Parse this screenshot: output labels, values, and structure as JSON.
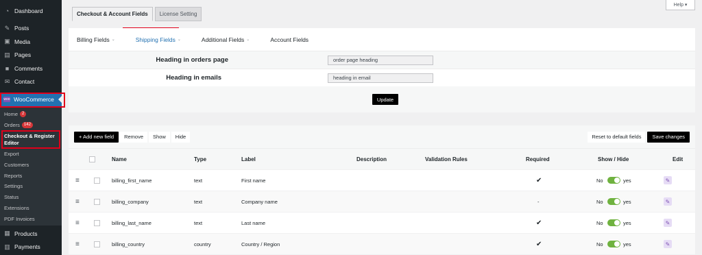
{
  "sidebar": {
    "items": [
      {
        "label": "Dashboard",
        "icon": "dashboard-icon"
      },
      {
        "label": "Posts",
        "icon": "pin-icon"
      },
      {
        "label": "Media",
        "icon": "media-icon"
      },
      {
        "label": "Pages",
        "icon": "pages-icon"
      },
      {
        "label": "Comments",
        "icon": "comments-icon"
      },
      {
        "label": "Contact",
        "icon": "mail-icon"
      }
    ],
    "woocommerce": "WooCommerce",
    "woo_icon_text": "woo",
    "submenu": [
      {
        "label": "Home",
        "badge": "2"
      },
      {
        "label": "Orders",
        "badge": "142"
      },
      {
        "label": "Checkout & Register Editor",
        "active": true
      },
      {
        "label": "Export"
      },
      {
        "label": "Customers"
      },
      {
        "label": "Reports"
      },
      {
        "label": "Settings"
      },
      {
        "label": "Status"
      },
      {
        "label": "Extensions"
      },
      {
        "label": "PDF Invoices"
      }
    ],
    "bottom": [
      {
        "label": "Products",
        "icon": "products-icon"
      },
      {
        "label": "Payments",
        "icon": "payments-icon"
      }
    ]
  },
  "help": "Help ▾",
  "nav_tabs": [
    "Checkout & Account Fields",
    "License Setting"
  ],
  "sub_tabs": [
    {
      "label": "Billing Fields",
      "caret": "⌄"
    },
    {
      "label": "Shipping Fields",
      "caret": "⌄"
    },
    {
      "label": "Additional Fields",
      "caret": "⌄"
    },
    {
      "label": "Account Fields",
      "caret": ""
    }
  ],
  "settings": {
    "orders_label": "Heading in orders page",
    "orders_value": "order page heading",
    "emails_label": "Heading in emails",
    "emails_value": "heading in email",
    "update": "Update"
  },
  "toolbar": {
    "add": "+ Add new field",
    "remove": "Remove",
    "show": "Show",
    "hide": "Hide",
    "reset": "Reset to default fields",
    "save": "Save changes"
  },
  "table": {
    "headers": [
      "Name",
      "Type",
      "Label",
      "Description",
      "Validation Rules",
      "Required",
      "Show / Hide",
      "Edit"
    ],
    "toggle_no": "No",
    "toggle_yes": "yes",
    "rows": [
      {
        "name": "billing_first_name",
        "type": "text",
        "label": "First name",
        "required": "✔"
      },
      {
        "name": "billing_company",
        "type": "text",
        "label": "Company name",
        "required": "-"
      },
      {
        "name": "billing_last_name",
        "type": "text",
        "label": "Last name",
        "required": "✔"
      },
      {
        "name": "billing_country",
        "type": "country",
        "label": "Country / Region",
        "required": "✔"
      }
    ]
  },
  "colors": {
    "accent": "#2271b1",
    "highlight": "#e1001a",
    "toggle": "#6fb23f",
    "sidebar": "#1d2327"
  }
}
